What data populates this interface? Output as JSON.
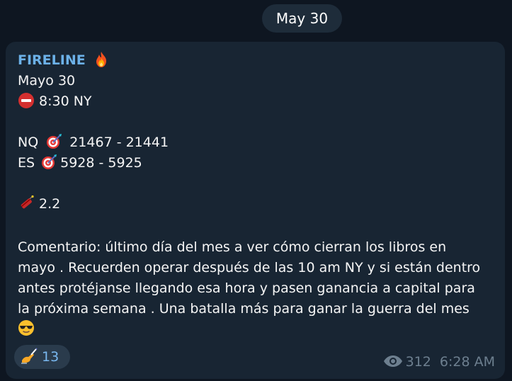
{
  "date_header": "May 30",
  "message": {
    "sender": "FIRELINE",
    "sender_icon": "fire-icon",
    "lines": {
      "date": "Mayo 30",
      "time": "8:30 NY",
      "nq": "NQ",
      "nq_range": "21467 - 21441",
      "es": "ES",
      "es_range": "5928 - 5925",
      "ratio": "2.2"
    },
    "comment_lines": [
      "Comentario: último día del mes a ver cómo cierran los libros en",
      "mayo . Recuerden operar después de las 10 am NY y si están dentro",
      "antes protéjanse llegando esa hora y pasen ganancia a capital para",
      "la próxima semana . Una batalla más para ganar la guerra del mes"
    ],
    "icons": {
      "stop": "stop-sign-icon",
      "target": "target-dart-icon",
      "dynamite": "dynamite-icon",
      "sunglasses": "sunglasses-emoji-icon",
      "reaction": "writing-hand-icon",
      "views": "eye-icon"
    }
  },
  "reaction": {
    "count": "13"
  },
  "meta": {
    "views": "312",
    "time": "6:28 AM"
  },
  "colors": {
    "background": "#0e1621",
    "bubble": "#182533",
    "sender": "#6cb1e8",
    "meta_text": "#6d7f8f"
  }
}
